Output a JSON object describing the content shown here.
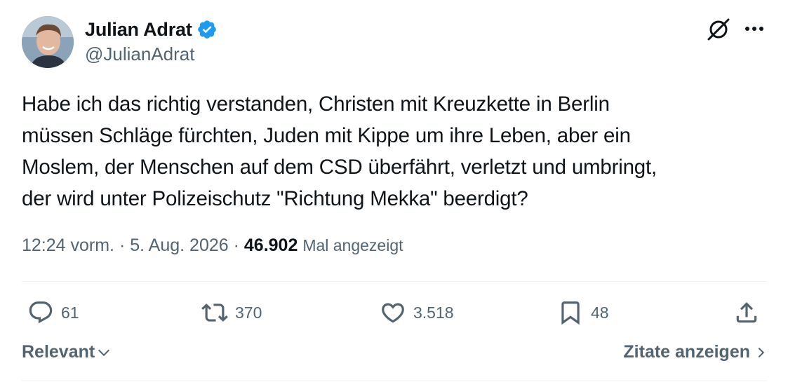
{
  "author": {
    "display_name": "Julian Adrat",
    "handle": "@JulianAdrat",
    "verified": true,
    "verified_color": "#1d9bf0"
  },
  "header_icons": [
    "grok-icon",
    "more-icon"
  ],
  "tweet": {
    "text": "Habe ich das richtig verstanden, Christen mit Kreuzkette in Berlin\nmüssen Schläge fürchten, Juden mit Kippe um ihre Leben, aber ein\nMoslem, der Menschen auf dem CSD überfährt, verletzt und umbringt,\nder wird unter Polizeischutz \"Richtung Mekka\" beerdigt?"
  },
  "meta": {
    "time": "12:24 vorm.",
    "separator": "·",
    "date": "5. Aug. 2026",
    "views_count": "46.902",
    "views_label": "Mal angezeigt"
  },
  "actions": {
    "replies": "61",
    "reposts": "370",
    "likes": "3.518",
    "bookmarks": "48"
  },
  "footer": {
    "sort_label": "Relevant",
    "quotes_label": "Zitate anzeigen"
  },
  "colors": {
    "text": "#0f1419",
    "secondary": "#536471",
    "divider": "#eff3f4"
  }
}
